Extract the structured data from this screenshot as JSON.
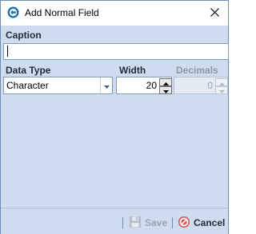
{
  "dialog": {
    "title": "Add Normal Field",
    "close_glyph": "✕"
  },
  "caption": {
    "label": "Caption",
    "value": ""
  },
  "data_type": {
    "label": "Data Type",
    "value": "Character"
  },
  "width": {
    "label": "Width",
    "value": "20"
  },
  "decimals": {
    "label": "Decimals",
    "value": "0",
    "enabled": false
  },
  "footer": {
    "save_label": "Save",
    "save_enabled": false,
    "cancel_label": "Cancel"
  },
  "icons": {
    "app": "app-logo-icon",
    "close": "close-icon",
    "dropdown": "chevron-down-icon",
    "save": "floppy-disk-icon",
    "cancel": "cancel-circle-icon"
  },
  "colors": {
    "panel_bg": "#cfdcef",
    "border": "#7f9db9",
    "label_text": "#1e2d3d",
    "disabled_text": "#9aa5b3",
    "cancel_icon": "#d9534f"
  }
}
